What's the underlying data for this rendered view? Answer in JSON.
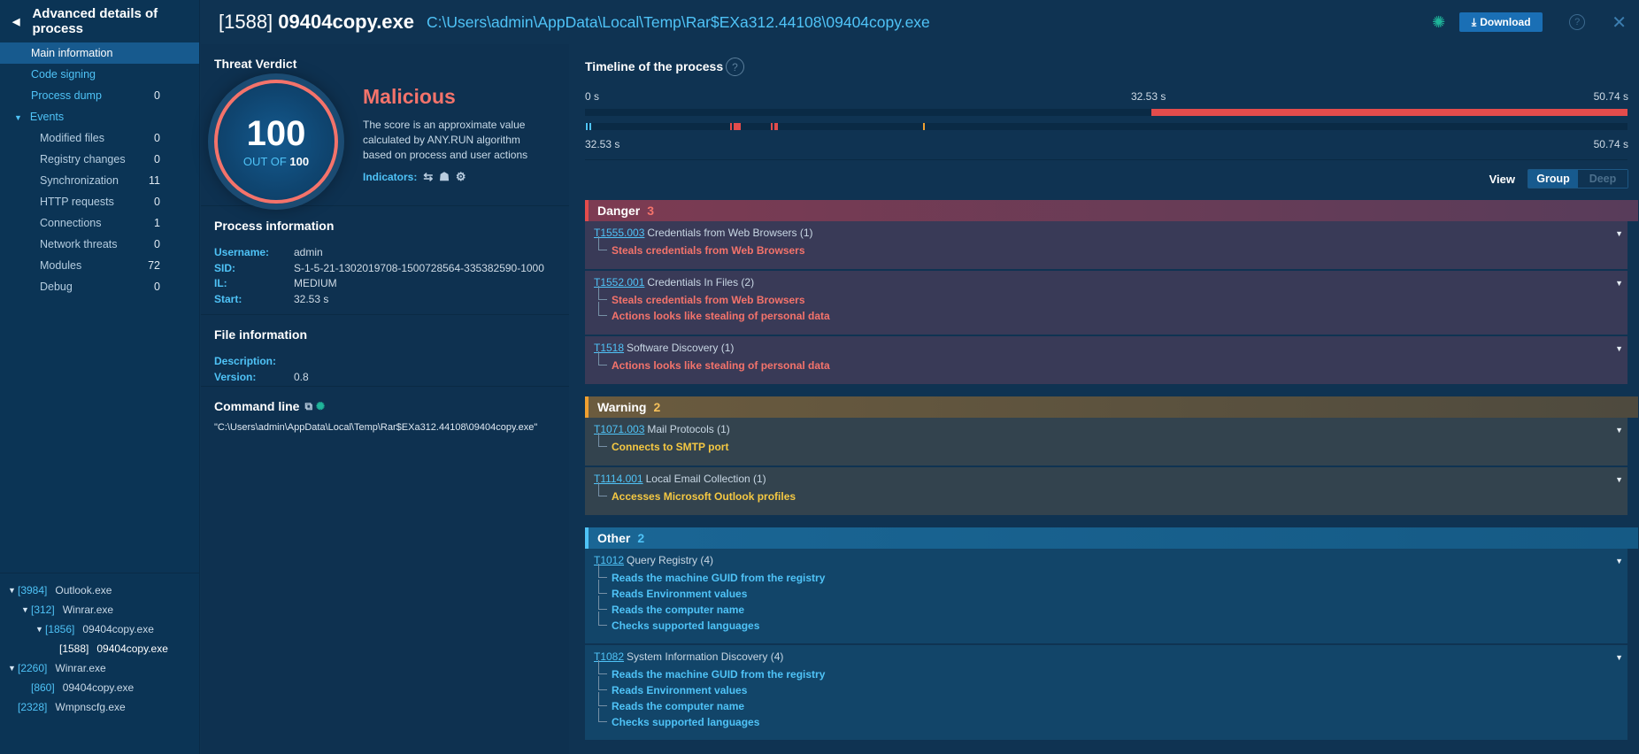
{
  "sidebar": {
    "title": "Advanced details of process",
    "items": [
      {
        "label": "Main information",
        "count": ""
      },
      {
        "label": "Code signing",
        "count": ""
      },
      {
        "label": "Process dump",
        "count": "0"
      },
      {
        "label": "Events",
        "count": ""
      },
      {
        "label": "Modified files",
        "count": "0"
      },
      {
        "label": "Registry changes",
        "count": "0"
      },
      {
        "label": "Synchronization",
        "count": "11"
      },
      {
        "label": "HTTP requests",
        "count": "0"
      },
      {
        "label": "Connections",
        "count": "1"
      },
      {
        "label": "Network threats",
        "count": "0"
      },
      {
        "label": "Modules",
        "count": "72"
      },
      {
        "label": "Debug",
        "count": "0"
      }
    ],
    "tree": [
      {
        "pid": "[3984]",
        "name": "Outlook.exe"
      },
      {
        "pid": "[312]",
        "name": "Winrar.exe"
      },
      {
        "pid": "[1856]",
        "name": "09404copy.exe"
      },
      {
        "pid": "[1588]",
        "name": "09404copy.exe"
      },
      {
        "pid": "[2260]",
        "name": "Winrar.exe"
      },
      {
        "pid": "[860]",
        "name": "09404copy.exe"
      },
      {
        "pid": "[2328]",
        "name": "Wmpnscfg.exe"
      }
    ]
  },
  "header": {
    "pid": "[1588]",
    "name": "09404copy.exe",
    "path": "C:\\Users\\admin\\AppData\\Local\\Temp\\Rar$EXa312.44108\\09404copy.exe",
    "download_label": "Download"
  },
  "verdict": {
    "section_title": "Threat Verdict",
    "score": "100",
    "out_of_label": "OUT OF",
    "out_of_value": "100",
    "label": "Malicious",
    "description": "The score is an approximate value calculated by ANY.RUN algorithm based on process and user actions",
    "indicators_label": "Indicators:",
    "accent": "#f4736b"
  },
  "process_info": {
    "title": "Process information",
    "rows": [
      {
        "k": "Username:",
        "v": "admin"
      },
      {
        "k": "SID:",
        "v": "S-1-5-21-1302019708-1500728564-335382590-1000"
      },
      {
        "k": "IL:",
        "v": "MEDIUM"
      },
      {
        "k": "Start:",
        "v": "32.53 s"
      }
    ]
  },
  "file_info": {
    "title": "File information",
    "rows": [
      {
        "k": "Description:",
        "v": ""
      },
      {
        "k": "Version:",
        "v": "0.8"
      }
    ]
  },
  "command_line": {
    "title": "Command line",
    "value": "\"C:\\Users\\admin\\AppData\\Local\\Temp\\Rar$EXa312.44108\\09404copy.exe\""
  },
  "timeline": {
    "title": "Timeline of the process",
    "start": "0 s",
    "mid": "32.53 s",
    "end": "50.74 s",
    "zoom_start": "32.53 s",
    "zoom_end": "50.74 s"
  },
  "view": {
    "label": "View",
    "group": "Group",
    "deep": "Deep"
  },
  "categories": {
    "danger": {
      "label": "Danger",
      "count": "3",
      "color": "#e34c4c"
    },
    "warning": {
      "label": "Warning",
      "count": "2",
      "color": "#f0a030"
    },
    "other": {
      "label": "Other",
      "count": "2",
      "color": "#4fc3f7"
    }
  },
  "groups": {
    "g1": {
      "id": "T1555.003",
      "name": "Credentials from Web Browsers (1)",
      "items": [
        "Steals credentials from Web Browsers"
      ]
    },
    "g2": {
      "id": "T1552.001",
      "name": "Credentials In Files (2)",
      "items": [
        "Steals credentials from Web Browsers",
        "Actions looks like stealing of personal data"
      ]
    },
    "g3": {
      "id": "T1518",
      "name": "Software Discovery (1)",
      "items": [
        "Actions looks like stealing of personal data"
      ]
    },
    "g4": {
      "id": "T1071.003",
      "name": "Mail Protocols (1)",
      "items": [
        "Connects to SMTP port"
      ]
    },
    "g5": {
      "id": "T1114.001",
      "name": "Local Email Collection (1)",
      "items": [
        "Accesses Microsoft Outlook profiles"
      ]
    },
    "g6": {
      "id": "T1012",
      "name": "Query Registry (4)",
      "items": [
        "Reads the machine GUID from the registry",
        "Reads Environment values",
        "Reads the computer name",
        "Checks supported languages"
      ]
    },
    "g7": {
      "id": "T1082",
      "name": "System Information Discovery (4)",
      "items": [
        "Reads the machine GUID from the registry",
        "Reads Environment values",
        "Reads the computer name",
        "Checks supported languages"
      ]
    }
  }
}
